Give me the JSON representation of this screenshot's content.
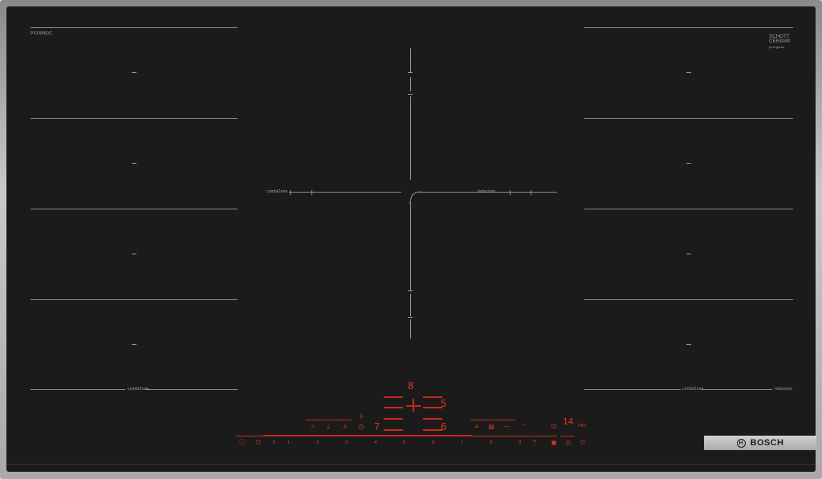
{
  "brand": {
    "name": "BOSCH",
    "logo_glyph": "H"
  },
  "glass_marks": {
    "top_left_model": "PXX985DC",
    "top_right_line1": "SCHOTT",
    "top_right_line2": "CERAN®",
    "top_right_line3": "pureglass"
  },
  "zones": {
    "left_flex_label": "combiZone",
    "right_flex_label": "combiZone",
    "center_left_label": "combiZone",
    "center_right_label": "Induction",
    "bottom_right_label": "Induction"
  },
  "control_panel": {
    "display_top": "8",
    "display_left": "7",
    "display_right_top": "5",
    "display_right_bottom": "6",
    "timer_display": "14",
    "timer_unit": "min",
    "power_scale": [
      "0",
      "1",
      "2",
      "3",
      "4",
      "5",
      "6",
      "7",
      "8",
      "9"
    ],
    "icons_left": [
      "wave-icon",
      "arrow-icon",
      "fan-icon"
    ],
    "icons_right": [
      "move-icon",
      "grid-icon",
      "minus-icon",
      "wifi-icon"
    ]
  },
  "colors": {
    "glass": "#1b1b1b",
    "touch_red": "#e8341c",
    "frame": "#b5b5b5"
  }
}
